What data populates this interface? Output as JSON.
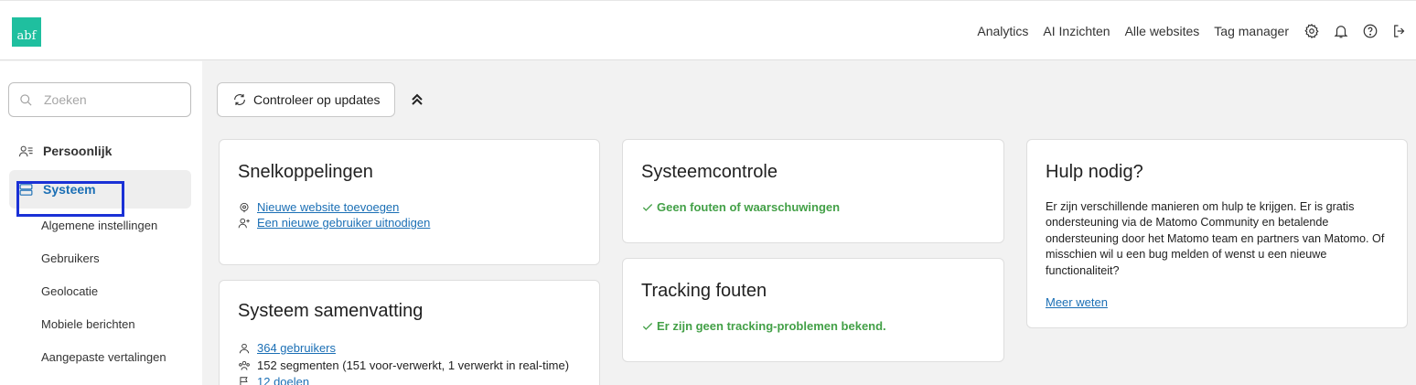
{
  "header": {
    "logo_text": "abf",
    "nav": [
      "Analytics",
      "AI Inzichten",
      "Alle websites",
      "Tag manager"
    ],
    "icons": [
      "gear-icon",
      "bell-icon",
      "help-icon",
      "logout-icon"
    ]
  },
  "sidebar": {
    "search_placeholder": "Zoeken",
    "sections": [
      {
        "label": "Persoonlijk",
        "icon": "user-list-icon"
      },
      {
        "label": "Systeem",
        "icon": "server-icon"
      }
    ],
    "subitems": [
      "Algemene instellingen",
      "Gebruikers",
      "Geolocatie",
      "Mobiele berichten",
      "Aangepaste vertalingen"
    ],
    "highlighted_item": "Gebruikers"
  },
  "toolbar": {
    "update_button": "Controleer op updates"
  },
  "cards": {
    "shortcuts": {
      "title": "Snelkoppelingen",
      "links": [
        "Nieuwe website toevoegen",
        "Een nieuwe gebruiker uitnodigen"
      ]
    },
    "summary": {
      "title": "Systeem samenvatting",
      "users_link": "364 gebruikers",
      "segments": "152 segmenten (151 voor-verwerkt, 1 verwerkt in real-time)",
      "goals_link": "12 doelen"
    },
    "systemcheck": {
      "title": "Systeemcontrole",
      "status": "Geen fouten of waarschuwingen"
    },
    "tracking": {
      "title": "Tracking fouten",
      "status": "Er zijn geen tracking-problemen bekend."
    },
    "help": {
      "title": "Hulp nodig?",
      "text": "Er zijn verschillende manieren om hulp te krijgen. Er is gratis ondersteuning via de Matomo Community en betalende ondersteuning door het Matomo team en partners van Matomo. Of misschien wil u een bug melden of wenst u een nieuwe functionaliteit?",
      "link": "Meer weten"
    }
  },
  "colors": {
    "accent": "#1b6fb5",
    "success": "#43a047",
    "logo": "#1fbf9f",
    "highlight_box": "#1a31d6"
  }
}
